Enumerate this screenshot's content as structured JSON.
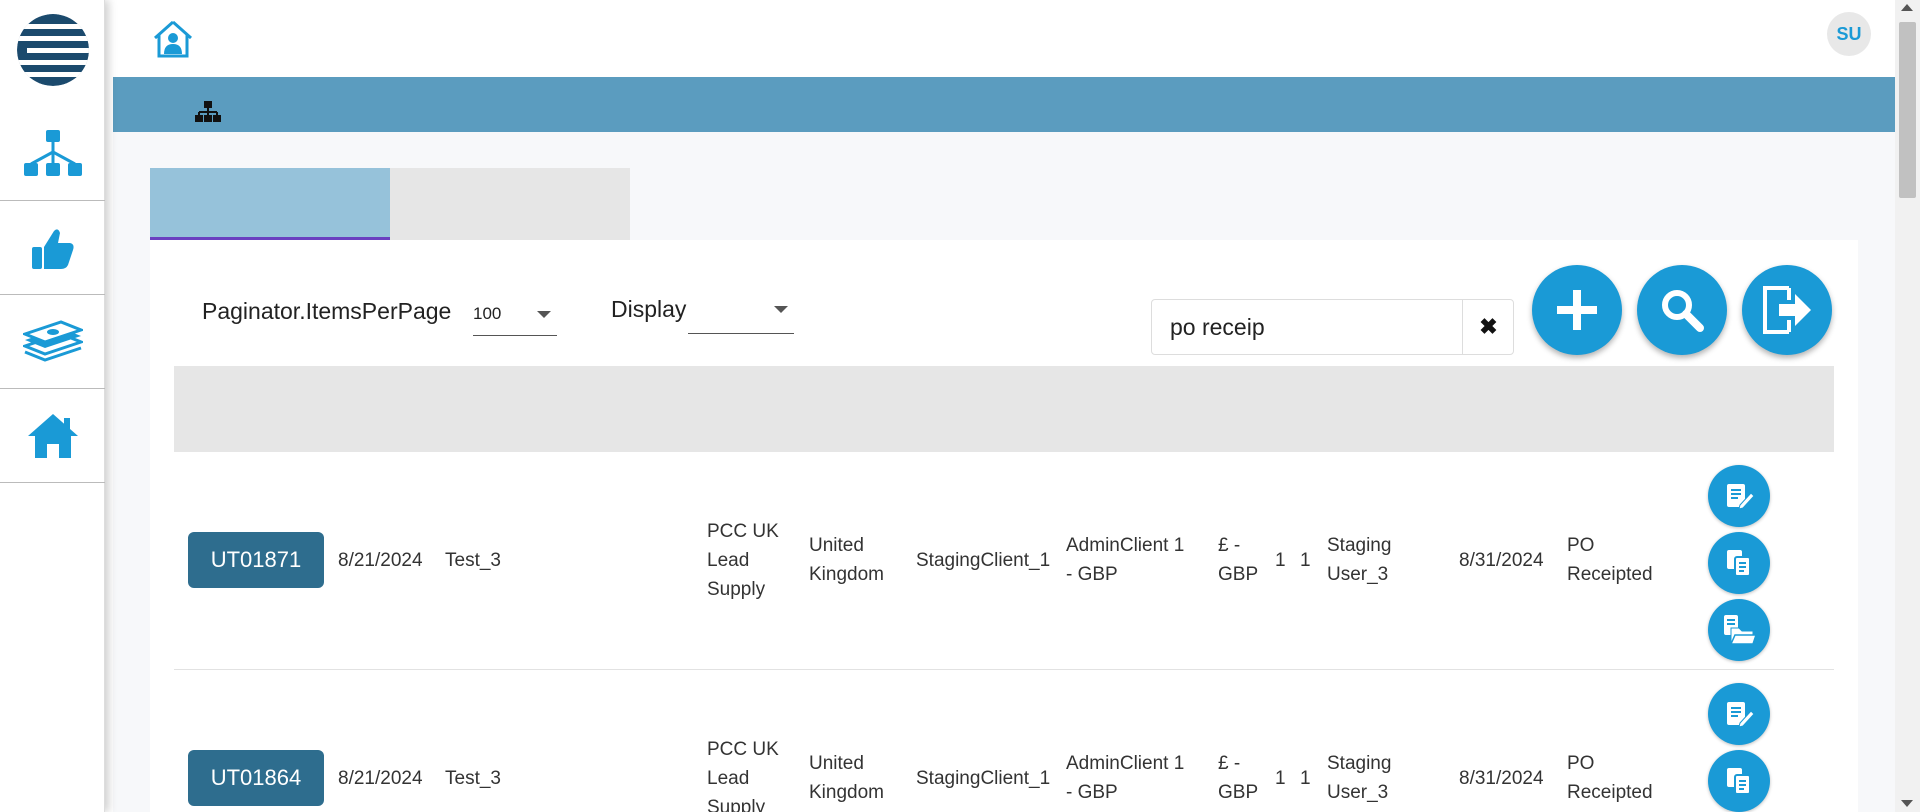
{
  "header": {
    "avatar_initials": "SU"
  },
  "controls": {
    "items_per_page_label": "Paginator.ItemsPerPage",
    "items_per_page_value": "100",
    "display_label": "Display",
    "display_value": "",
    "search_value": "po receip",
    "clear_symbol": "✖"
  },
  "rows": [
    {
      "ref": "UT01871",
      "date": "8/21/2024",
      "name": "Test_3",
      "supplier": [
        "PCC UK",
        "Lead",
        "Supply"
      ],
      "country": [
        "United",
        "Kingdom"
      ],
      "client": "StagingClient_1",
      "admin_client": [
        "AdminClient 1",
        "- GBP"
      ],
      "currency": [
        "£ -",
        "GBP"
      ],
      "n1": "1",
      "n2": "1",
      "user": [
        "Staging",
        "User_3"
      ],
      "due": "8/31/2024",
      "status": [
        "PO",
        "Receipted"
      ]
    },
    {
      "ref": "UT01864",
      "date": "8/21/2024",
      "name": "Test_3",
      "supplier": [
        "PCC UK",
        "Lead",
        "Supply"
      ],
      "country": [
        "United",
        "Kingdom"
      ],
      "client": "StagingClient_1",
      "admin_client": [
        "AdminClient 1",
        "- GBP"
      ],
      "currency": [
        "£ -",
        "GBP"
      ],
      "n1": "1",
      "n2": "1",
      "user": [
        "Staging",
        "User_3"
      ],
      "due": "8/31/2024",
      "status": [
        "PO",
        "Receipted"
      ]
    }
  ],
  "colors": {
    "accent": "#1a9ad6",
    "bar": "#5b9cbf",
    "ref_button": "#2e6d8e",
    "active_tab": "#96c2da",
    "tab_underline": "#6a3fc0"
  },
  "icons": {
    "logo": "striped-globe-logo",
    "sidebar": [
      "hierarchy-icon",
      "thumbs-up-icon",
      "money-stack-icon",
      "home-icon"
    ],
    "header": "home-user-icon",
    "bar": "org-chart-icon",
    "fabs": [
      "plus-icon",
      "search-icon",
      "exit-icon"
    ],
    "row_actions": [
      "edit-document-icon",
      "copy-document-icon",
      "open-folder-document-icon"
    ]
  }
}
